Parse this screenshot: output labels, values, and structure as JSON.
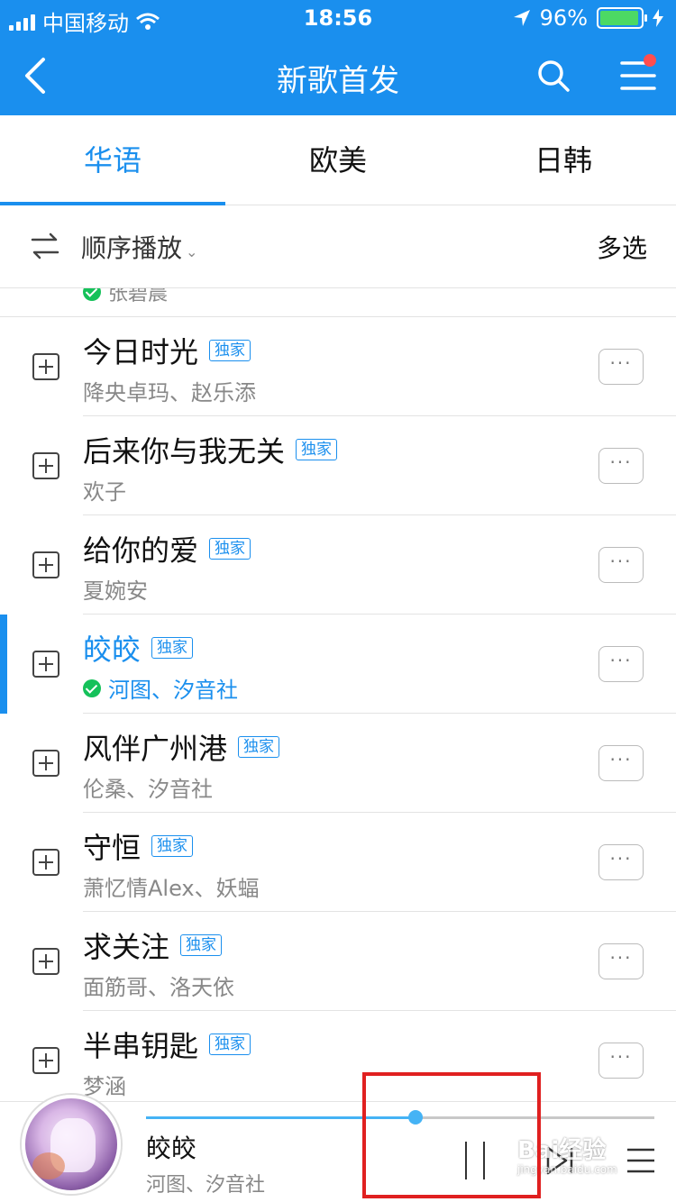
{
  "status_bar": {
    "carrier": "中国移动",
    "time": "18:56",
    "battery_percent": "96%",
    "battery_level": 0.96
  },
  "nav": {
    "title": "新歌首发"
  },
  "tabs": [
    {
      "label": "华语",
      "active": true
    },
    {
      "label": "欧美",
      "active": false
    },
    {
      "label": "日韩",
      "active": false
    }
  ],
  "toolbar": {
    "order_label": "顺序播放",
    "multi_select": "多选"
  },
  "partial_row": {
    "artist": "张碧晨"
  },
  "songs": [
    {
      "title": "今日时光",
      "badge": "独家",
      "artist": "降央卓玛、赵乐添",
      "playing": false,
      "downloaded": false,
      "more": "···"
    },
    {
      "title": "后来你与我无关",
      "badge": "独家",
      "artist": "欢子",
      "playing": false,
      "downloaded": false,
      "more": "···"
    },
    {
      "title": "给你的爱",
      "badge": "独家",
      "artist": "夏婉安",
      "playing": false,
      "downloaded": false,
      "more": "···"
    },
    {
      "title": "皎皎",
      "badge": "独家",
      "artist": "河图、汐音社",
      "playing": true,
      "downloaded": true,
      "more": "···"
    },
    {
      "title": "风伴广州港",
      "badge": "独家",
      "artist": "伦桑、汐音社",
      "playing": false,
      "downloaded": false,
      "more": "···"
    },
    {
      "title": "守恒",
      "badge": "独家",
      "artist": "萧忆情Alex、妖蝠",
      "playing": false,
      "downloaded": false,
      "more": "···"
    },
    {
      "title": "求关注",
      "badge": "独家",
      "artist": "面筋哥、洛天依",
      "playing": false,
      "downloaded": false,
      "more": "···"
    },
    {
      "title": "半串钥匙",
      "badge": "独家",
      "artist": "梦涵",
      "playing": false,
      "downloaded": false,
      "more": "···"
    }
  ],
  "player": {
    "song": "皎皎",
    "artist": "河图、汐音社",
    "progress": 0.53
  },
  "watermark": {
    "text": "Bai经验",
    "sub": "jingyan.baidu.com"
  },
  "colors": {
    "accent": "#1a8fee",
    "badge": "#1a8fee",
    "check": "#15c15a",
    "notify_dot": "#ff4d4f",
    "highlight": "#e02020"
  }
}
